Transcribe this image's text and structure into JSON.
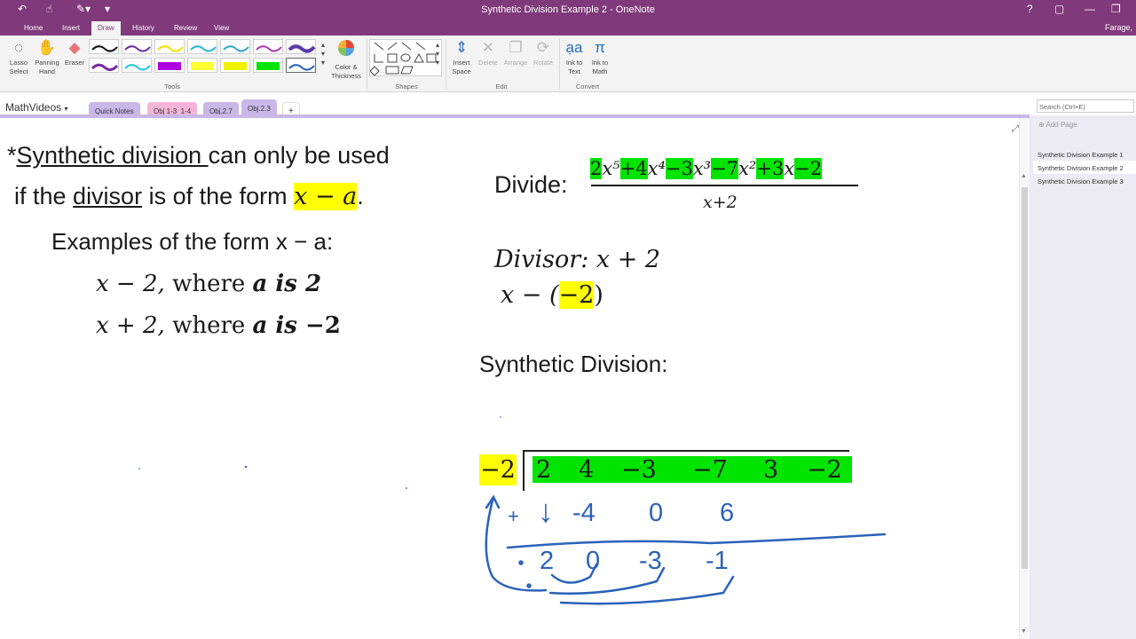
{
  "titlebar": {
    "title": "Synthetic Division Example 2 - OneNote",
    "undo_icon": "↶",
    "touch_icon": "☝",
    "qa_menu_icon": "▾",
    "help_label": "?",
    "restore_label": "▢",
    "minimize_label": "—",
    "maximize_label": "❐",
    "user": "Farage,"
  },
  "ribbon": {
    "tabs": [
      "Home",
      "Insert",
      "Draw",
      "History",
      "Review",
      "View"
    ],
    "active_tab": "Draw",
    "tools": {
      "lasso_label": "Lasso Select",
      "panning_label": "Panning Hand",
      "eraser_label": "Eraser",
      "color_label": "Color & Thickness",
      "group_label": "Tools"
    },
    "shapes_group": "Shapes",
    "edit": {
      "insert_space_label": "Insert Space",
      "delete_label": "Delete",
      "arrange_label": "Arrange",
      "rotate_label": "Rotate",
      "group_label": "Edit"
    },
    "convert": {
      "ink_to_text_label": "Ink to Text",
      "ink_to_math_label": "Ink to Math",
      "group_label": "Convert"
    }
  },
  "notebook": {
    "name": "MathVideos",
    "sections": [
      "Quick Notes",
      "Obj 1-3_1-4",
      "Obj.2.7",
      "Obj.2.3"
    ],
    "section_colors": [
      "#c9b7e8",
      "#f3b4d8",
      "#c9b7e8",
      "#c9b7e8"
    ],
    "add_section": "+",
    "search_placeholder": "Search (Ctrl+E)"
  },
  "pages": {
    "add_page": "Add Page",
    "items": [
      "Synthetic Division Example 1",
      "Synthetic Division Example 2",
      "Synthetic Division Example 3"
    ]
  },
  "note": {
    "rule_star": "*",
    "rule_underlined": "Synthetic division ",
    "rule_rest": "can only be used",
    "rule_line2_prefix": "if the ",
    "rule_line2_underlined": "divisor",
    "rule_line2_mid": " is of the form ",
    "rule_line2_math": "x − a",
    "rule_line2_end": ".",
    "examples_heading": "Examples of the form x − a:",
    "example1_expr": "x − 2,",
    "example1_where": "where ",
    "example1_bold": "a is 2",
    "example2_expr": "x  +  2,",
    "example2_where": "where ",
    "example2_bold": "a is",
    "example2_value": " −2",
    "divide_label": "Divide:",
    "numerator_terms": [
      "2",
      "x⁵",
      "+4",
      "x⁴",
      "−3",
      "x³",
      "−7",
      "x²",
      "+3",
      "x",
      "−2"
    ],
    "denominator": "x+2",
    "divisor_label": "Divisor:",
    "divisor_expr": "x + 2",
    "divisor_rewrite_prefix": "x −  (",
    "divisor_rewrite_value": "−2",
    "divisor_rewrite_suffix": ")",
    "synthetic_heading": "Synthetic Division:",
    "root": "−2",
    "coefficients": [
      "2",
      "4",
      "−3",
      "−7",
      "3",
      "−2"
    ],
    "ink_row2": [
      "+",
      "↓",
      "-4",
      "0",
      "6"
    ],
    "ink_row3": [
      "2",
      "0",
      "-3",
      "-1"
    ]
  },
  "colors": {
    "titlebar": "#80397b",
    "highlight_yellow": "#ffff00",
    "highlight_green": "#00e400",
    "ink_blue": "#2a62b8"
  }
}
